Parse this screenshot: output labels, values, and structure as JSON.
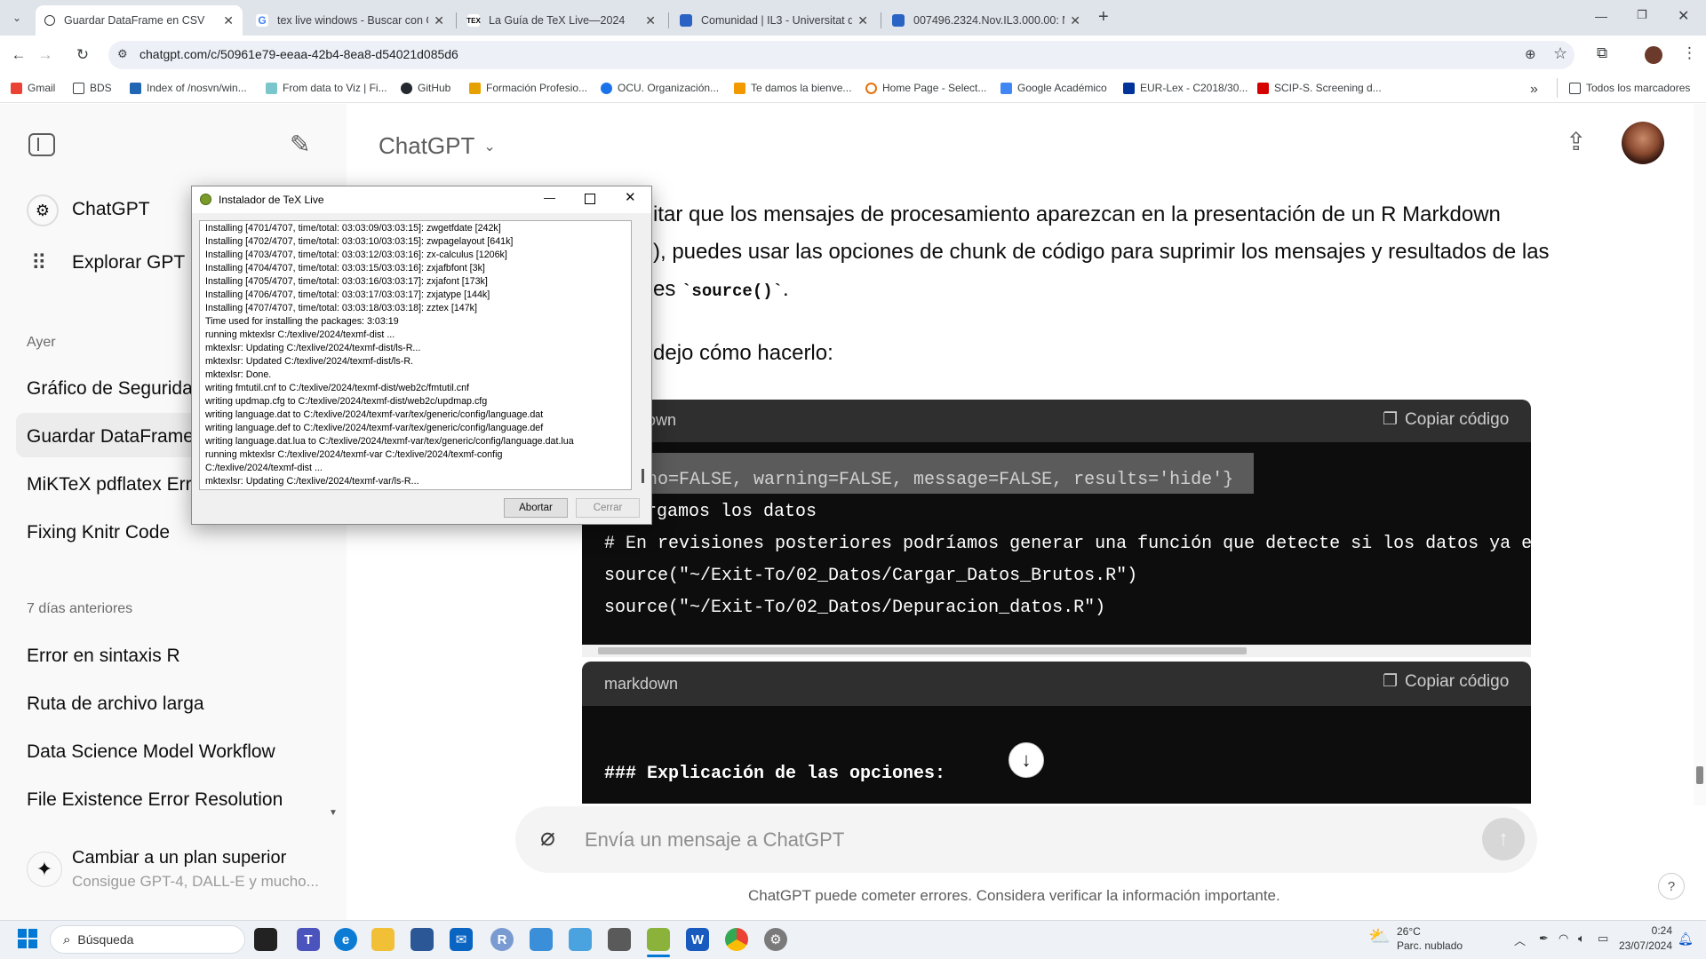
{
  "browser": {
    "tabs": [
      {
        "title": "Guardar DataFrame en CSV",
        "active": true
      },
      {
        "title": "tex live windows - Buscar con G"
      },
      {
        "title": "La Guía de TeX Live—2024"
      },
      {
        "title": "Comunidad | IL3 - Universitat d"
      },
      {
        "title": "007496.2324.Nov.IL3.000.00: M"
      }
    ],
    "new_tab": "+",
    "url": "chatgpt.com/c/50961e79-eeaa-42b4-8ea8-d54021d085d6",
    "bookmarks": [
      "Gmail",
      "BDS",
      "Index of /nosvn/win...",
      "From data to Viz | Fi...",
      "GitHub",
      "Formación Profesio...",
      "OCU. Organización...",
      "Te damos la bienve...",
      "Home Page - Select...",
      "Google Académico",
      "EUR-Lex - C2018/30...",
      "SCIP-S. Screening d..."
    ],
    "bookmarks_overflow": "»",
    "all_bookmarks": "Todos los marcadores"
  },
  "sidebar": {
    "top_items": [
      "ChatGPT",
      "Explorar GPT"
    ],
    "section_yesterday": "Ayer",
    "yesterday": [
      "Gráfico de Seguridad",
      "Guardar DataFrame",
      "MiKTeX pdflatex Error",
      "Fixing Knitr Code"
    ],
    "section_week": "7 días anteriores",
    "week": [
      "Error en sintaxis R",
      "Ruta de archivo larga",
      "Data Science Model Workflow",
      "File Existence Error Resolution"
    ],
    "upgrade_title": "Cambiar a un plan superior",
    "upgrade_sub": "Consigue GPT-4, DALL-E y mucho..."
  },
  "main": {
    "model": "ChatGPT",
    "para1_line1": "itar que los mensajes de procesamiento aparezcan en la presentación de un R Markdown",
    "para1_line2": "), puedes usar las opciones de chunk de código para suprimir los mensajes y resultados de las",
    "para1_line3_prefix": "es ",
    "para1_code": "`source()`",
    "para1_suffix": ".",
    "para2": "dejo cómo hacerlo:",
    "code1_lang": "own",
    "copy_label": "Copiar código",
    "code1_lines": [
      "r echo=FALSE, warning=FALSE, message=FALSE, results='hide'}",
      "argamos los datos",
      "# En revisiones posteriores podríamos generar una función que detecte si los datos ya están",
      "source(\"~/Exit-To/02_Datos/Cargar_Datos_Brutos.R\")",
      "source(\"~/Exit-To/02_Datos/Depuracion_datos.R\")"
    ],
    "code2_lang": "markdown",
    "code2_line": "### Explicación de las opciones:",
    "input_placeholder": "Envía un mensaje a ChatGPT",
    "disclaimer": "ChatGPT puede cometer errores. Considera verificar la información importante.",
    "help": "?"
  },
  "dialog": {
    "title": "Instalador de TeX Live",
    "log": [
      "Installing [4701/4707, time/total: 03:03:09/03:03:15]: zwgetfdate [242k]",
      "Installing [4702/4707, time/total: 03:03:10/03:03:15]: zwpagelayout [641k]",
      "Installing [4703/4707, time/total: 03:03:12/03:03:16]: zx-calculus [1206k]",
      "Installing [4704/4707, time/total: 03:03:15/03:03:16]: zxjafbfont [3k]",
      "Installing [4705/4707, time/total: 03:03:16/03:03:17]: zxjafont [173k]",
      "Installing [4706/4707, time/total: 03:03:17/03:03:17]: zxjatype [144k]",
      "Installing [4707/4707, time/total: 03:03:18/03:03:18]: zztex [147k]",
      "Time used for installing the packages: 3:03:19",
      "running mktexlsr C:/texlive/2024/texmf-dist ...",
      "mktexlsr: Updating C:/texlive/2024/texmf-dist/ls-R...",
      "mktexlsr: Updated C:/texlive/2024/texmf-dist/ls-R.",
      "mktexlsr: Done.",
      "writing fmtutil.cnf to C:/texlive/2024/texmf-dist/web2c/fmtutil.cnf",
      "writing updmap.cfg to C:/texlive/2024/texmf-dist/web2c/updmap.cfg",
      "writing language.dat to C:/texlive/2024/texmf-var/tex/generic/config/language.dat",
      "writing language.def to C:/texlive/2024/texmf-var/tex/generic/config/language.def",
      "writing language.dat.lua to C:/texlive/2024/texmf-var/tex/generic/config/language.dat.lua",
      "running mktexlsr C:/texlive/2024/texmf-var C:/texlive/2024/texmf-config",
      "C:/texlive/2024/texmf-dist ...",
      "mktexlsr: Updating C:/texlive/2024/texmf-var/ls-R..."
    ],
    "abort": "Abortar",
    "close": "Cerrar"
  },
  "taskbar": {
    "search": "Búsqueda",
    "temp": "26°C",
    "weather": "Parc. nublado",
    "time": "0:24",
    "date": "23/07/2024"
  },
  "colors": {
    "accent": "#10a37f",
    "chrome_bg": "#dfe3ea",
    "code_bg": "#0d0d0d"
  }
}
